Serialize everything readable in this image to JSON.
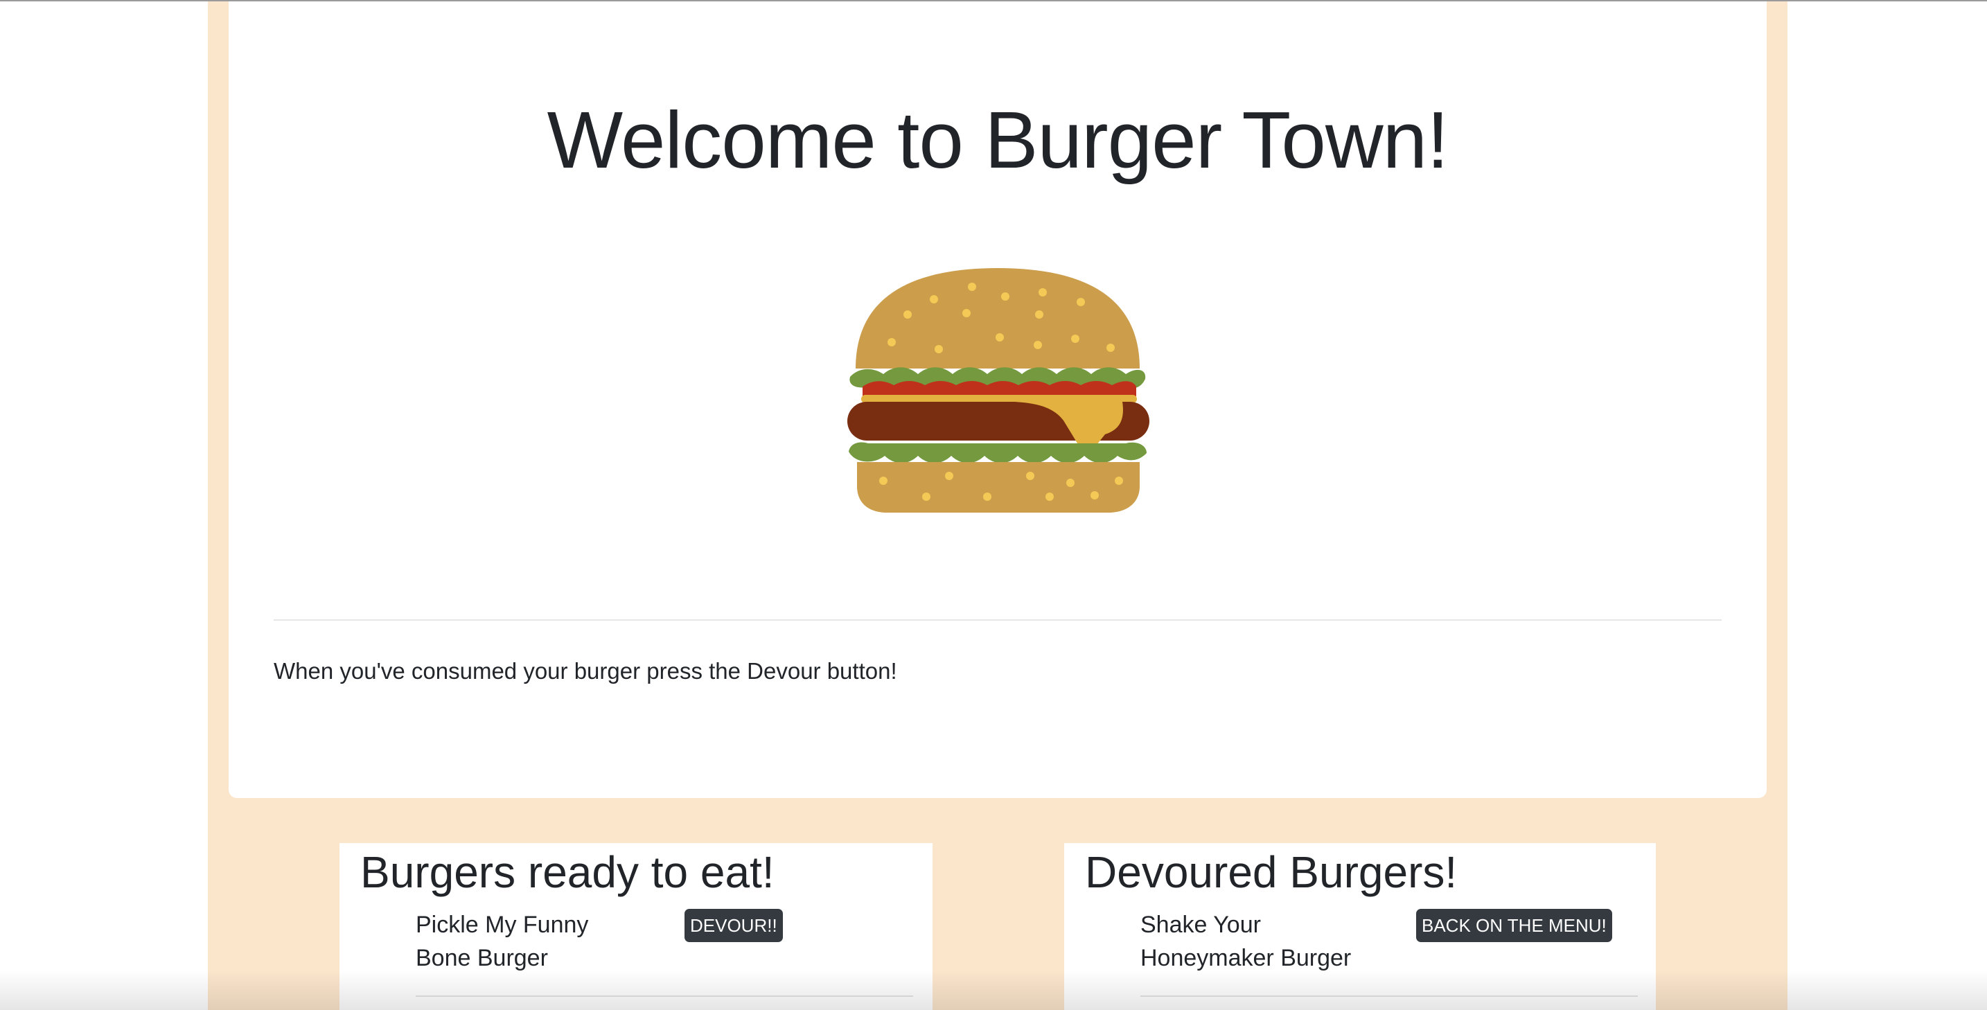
{
  "header": {
    "title": "Welcome to Burger Town!",
    "image_icon": "burger-icon"
  },
  "intro": {
    "text": "When you've consumed your burger press the Devour button!"
  },
  "ready": {
    "heading": "Burgers ready to eat!",
    "items": [
      {
        "name": "Pickle My Funny Bone Burger",
        "button_label": "DEVOUR!!"
      }
    ]
  },
  "devoured": {
    "heading": "Devoured Burgers!",
    "items": [
      {
        "name": "Shake Your Honeymaker Burger",
        "button_label": "BACK ON THE MENU!"
      }
    ]
  },
  "colors": {
    "page_background": "#fbe5cb",
    "panel_background": "#ffffff",
    "button_background": "#343a40",
    "button_text": "#ffffff",
    "bun": "#cc9e4c",
    "sesame": "#f4c955",
    "lettuce": "#74993f",
    "tomato": "#c0311c",
    "patty": "#7a2e11",
    "cheese": "#e2b13f"
  }
}
